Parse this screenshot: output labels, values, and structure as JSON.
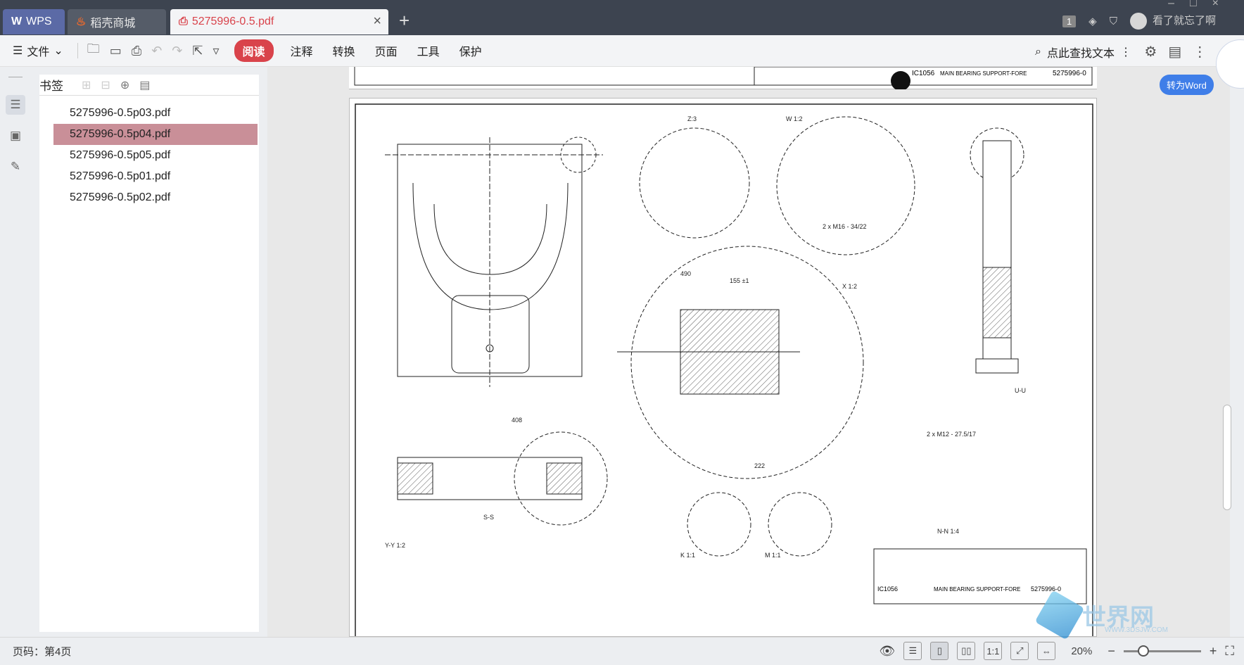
{
  "titlebar": {
    "tabs": [
      {
        "label": "WPS",
        "icon": "wps-logo-icon"
      },
      {
        "label": "稻壳商城",
        "icon": "flame-icon"
      },
      {
        "label": "5275996-0.5.pdf",
        "icon": "pdf-icon"
      }
    ],
    "badge": "1",
    "user_name": "看了就忘了啊"
  },
  "toolbar": {
    "file_label": "文件",
    "tabs": [
      "阅读",
      "注释",
      "转换",
      "页面",
      "工具",
      "保护"
    ],
    "search_placeholder": "点此查找文本"
  },
  "bookmarks": {
    "title": "书签",
    "items": [
      "5275996-0.5p03.pdf",
      "5275996-0.5p04.pdf",
      "5275996-0.5p05.pdf",
      "5275996-0.5p01.pdf",
      "5275996-0.5p02.pdf"
    ],
    "selected_index": 1
  },
  "convert_button": "转为Word",
  "drawing": {
    "title_block_name": "MAIN BEARING SUPPORT-FORE",
    "drawing_number": "5275996-0",
    "code": "IC1056",
    "section_labels": [
      "Z:3",
      "W 1:2",
      "X 1:2",
      "U-U",
      "S-S",
      "N-N 1:4",
      "Y-Y 1:2",
      "K 1:1",
      "M 1:1"
    ],
    "dims": [
      "490",
      "155 ±1",
      "408",
      "222",
      "2 x M16 - 34/22",
      "2 x M12 - 27.5/17"
    ]
  },
  "statusbar": {
    "page_label": "页码：第4页",
    "zoom": "20%"
  },
  "watermark": {
    "text": "世界网",
    "url": "WWW.3DSJW.COM"
  }
}
